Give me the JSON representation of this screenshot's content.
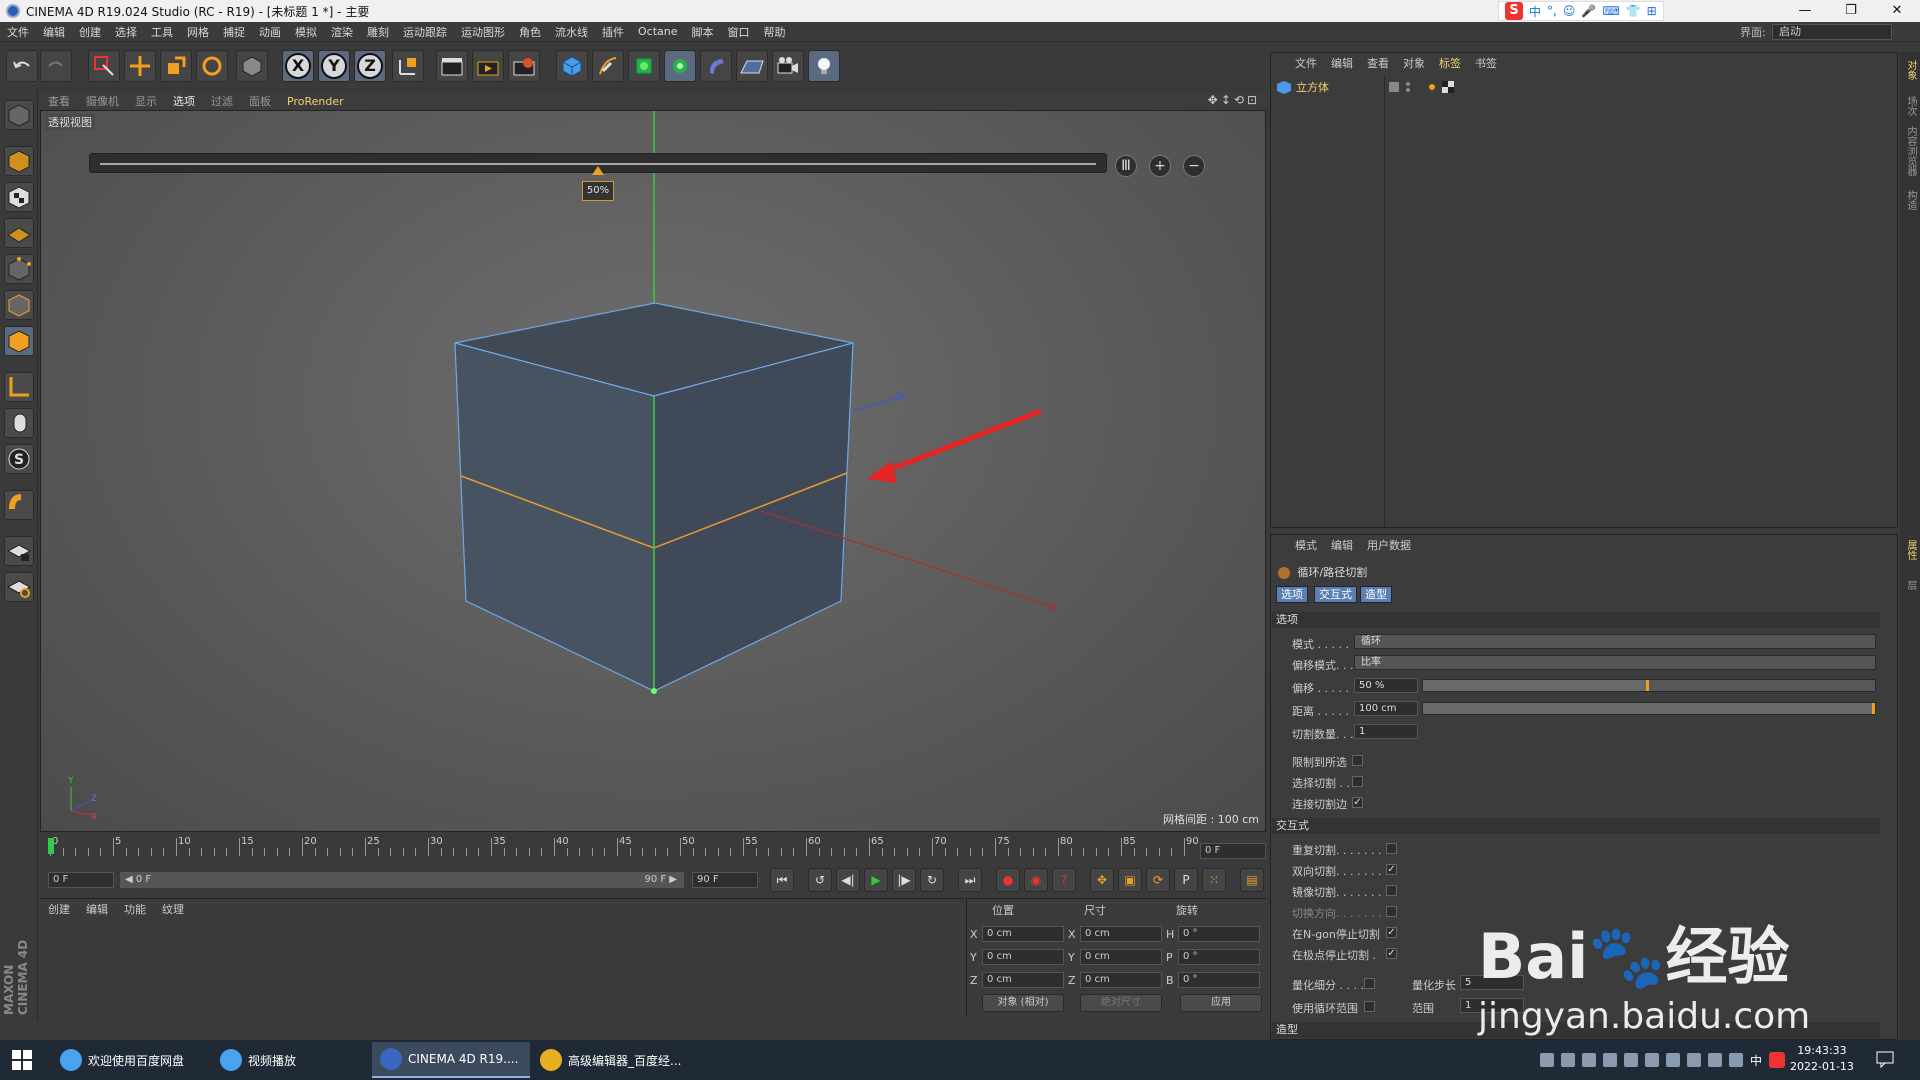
{
  "window": {
    "title": "CINEMA 4D R19.024 Studio (RC - R19) - [未标题 1 *] - 主要",
    "controls": [
      "—",
      "❐",
      "✕"
    ]
  },
  "ime": {
    "items": [
      "中",
      "°,",
      "☺",
      "🎤",
      "⌨",
      "👕",
      "⊞"
    ]
  },
  "menu": [
    "文件",
    "编辑",
    "创建",
    "选择",
    "工具",
    "网格",
    "捕捉",
    "动画",
    "模拟",
    "渲染",
    "雕刻",
    "运动跟踪",
    "运动图形",
    "角色",
    "流水线",
    "插件",
    "Octane",
    "脚本",
    "窗口",
    "帮助"
  ],
  "layout": {
    "label": "界面:",
    "value": "启动"
  },
  "toolbar": {
    "axes": [
      "X",
      "Y",
      "Z"
    ]
  },
  "viewport": {
    "menu": [
      "查看",
      "摄像机",
      "显示",
      "选项",
      "过滤",
      "面板",
      "ProRender"
    ],
    "active_menu": "选项",
    "label": "透视视图",
    "grid_spacing": "网格间距 : 100 cm",
    "slider_tip": "50%",
    "slider_value": 0.5,
    "buttons": [
      "Ⅲ",
      "+",
      "−"
    ],
    "nav_icons": "✥↕⟲⊡"
  },
  "timeline": {
    "ticks": [
      "0",
      "5",
      "10",
      "15",
      "20",
      "25",
      "30",
      "35",
      "40",
      "45",
      "50",
      "55",
      "60",
      "65",
      "70",
      "75",
      "80",
      "85",
      "90"
    ],
    "current": "0 F",
    "start": "0 F",
    "range_start": "◀ 0 F",
    "range_end": "90 F ▶",
    "end": "90 F"
  },
  "transport": {
    "play": [
      "⏮",
      "↺",
      "◀|",
      "▶",
      "|▶",
      "↻",
      "⏭"
    ],
    "rec": [
      "●",
      "◉",
      "?"
    ],
    "tools": [
      "✥",
      "▣",
      "⟳",
      "P",
      "⁙",
      "▤"
    ]
  },
  "material_manager": {
    "menu": [
      "创建",
      "编辑",
      "功能",
      "纹理"
    ]
  },
  "coords": {
    "headers": [
      "位置",
      "尺寸",
      "旋转"
    ],
    "rows": [
      {
        "a": "X",
        "pos": "0 cm",
        "b": "X",
        "size": "0 cm",
        "c": "H",
        "rot": "0 °"
      },
      {
        "a": "Y",
        "pos": "0 cm",
        "b": "Y",
        "size": "0 cm",
        "c": "P",
        "rot": "0 °"
      },
      {
        "a": "Z",
        "pos": "0 cm",
        "b": "Z",
        "size": "0 cm",
        "c": "B",
        "rot": "0 °"
      }
    ],
    "mode": "对象 (相对)",
    "size_mode": "绝对尺寸",
    "apply": "应用"
  },
  "object_manager": {
    "menu": [
      "文件",
      "编辑",
      "查看",
      "对象",
      "标签",
      "书签"
    ],
    "active_menu": "标签",
    "object_name": "立方体"
  },
  "attribute_manager": {
    "menu": [
      "模式",
      "编辑",
      "用户数据"
    ],
    "tool": "循环/路径切割",
    "tabs": [
      "选项",
      "交互式",
      "造型"
    ],
    "sections": {
      "options": "选项",
      "interactive": "交互式",
      "shaping": "造型"
    },
    "mode_label": "模式 . . . . .",
    "mode_value": "循环",
    "offset_mode_label": "偏移模式. . .",
    "offset_mode_value": "比率",
    "offset_label": "偏移 . . . . .",
    "offset_value": "50 %",
    "offset_fraction": 0.5,
    "distance_label": "距离 . . . . .",
    "distance_value": "100 cm",
    "distance_fraction": 1.0,
    "cuts_label": "切割数量. . .",
    "cuts_value": "1",
    "checks1": [
      {
        "label": "限制到所选",
        "checked": false,
        "disabled": false
      },
      {
        "label": "选择切割 . .",
        "checked": false,
        "disabled": false
      },
      {
        "label": "连接切割边",
        "checked": true,
        "disabled": false
      }
    ],
    "checks2": [
      {
        "label": "重复切割. . . . . . . .",
        "checked": false,
        "disabled": false
      },
      {
        "label": "双向切割. . . . . . . .",
        "checked": true,
        "disabled": false
      },
      {
        "label": "镜像切割. . . . . . . .",
        "checked": false,
        "disabled": false
      },
      {
        "label": "切换方向. . . . . . . .",
        "checked": false,
        "disabled": true
      },
      {
        "label": "在N-gon停止切割",
        "checked": true,
        "disabled": false
      },
      {
        "label": "在极点停止切割 .",
        "checked": true,
        "disabled": false
      }
    ],
    "quant_label": "量化细分 . . . .",
    "quant_step_label": "量化步长",
    "quant_step_value": "5",
    "loop_range_label": "使用循环范围",
    "range_label": "范围",
    "range_value": "1"
  },
  "right_strip": [
    "对象",
    "场次",
    "内容浏览器",
    "构造"
  ],
  "right_strip_lower": [
    "属性",
    "层"
  ],
  "maxon": "MAXON CINEMA 4D",
  "watermark": {
    "brand": "Bai🐾经验",
    "url": "jingyan.baidu.com"
  },
  "taskbar": {
    "items": [
      {
        "label": "欢迎使用百度网盘",
        "color": "#4aa3f0",
        "active": false
      },
      {
        "label": "视频播放",
        "color": "#4aa3f0",
        "active": false
      },
      {
        "label": "CINEMA 4D R19....",
        "color": "#3a66c0",
        "active": true
      },
      {
        "label": "高级编辑器_百度经...",
        "color": "#e8b020",
        "active": false
      }
    ],
    "tray_ime": "中",
    "time": "19:43:33",
    "date": "2022-01-13"
  },
  "colors": {
    "accent": "#f0a020",
    "cube_edge": "#6fa8e8",
    "cut_line": "#e89a30",
    "arrow": "#e62424"
  }
}
